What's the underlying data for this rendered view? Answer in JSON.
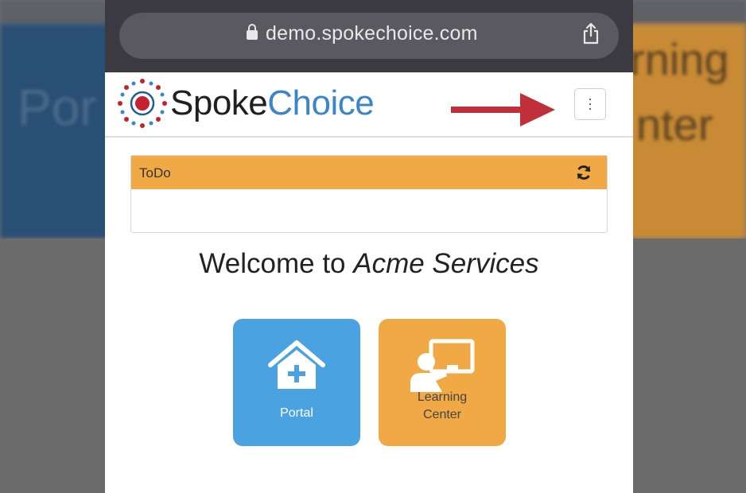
{
  "browser": {
    "url": "demo.spokechoice.com"
  },
  "background": {
    "left_text": "Por",
    "right_text_1": "rning",
    "right_text_2": "nter"
  },
  "header": {
    "logo_part1": "Spoke",
    "logo_part2": "Choice",
    "menu_icon": "vertical-ellipsis-icon",
    "arrow_color": "#c0303a"
  },
  "todo": {
    "title": "ToDo",
    "header_color": "#f0a944"
  },
  "welcome": {
    "prefix": "Welcome to ",
    "company": "Acme Services"
  },
  "tiles": [
    {
      "label": "Portal",
      "color": "#4aa2e0",
      "icon": "house-plus-icon"
    },
    {
      "label_line1": "Learning",
      "label_line2": "Center",
      "color": "#f0a944",
      "icon": "presenter-board-icon"
    }
  ]
}
